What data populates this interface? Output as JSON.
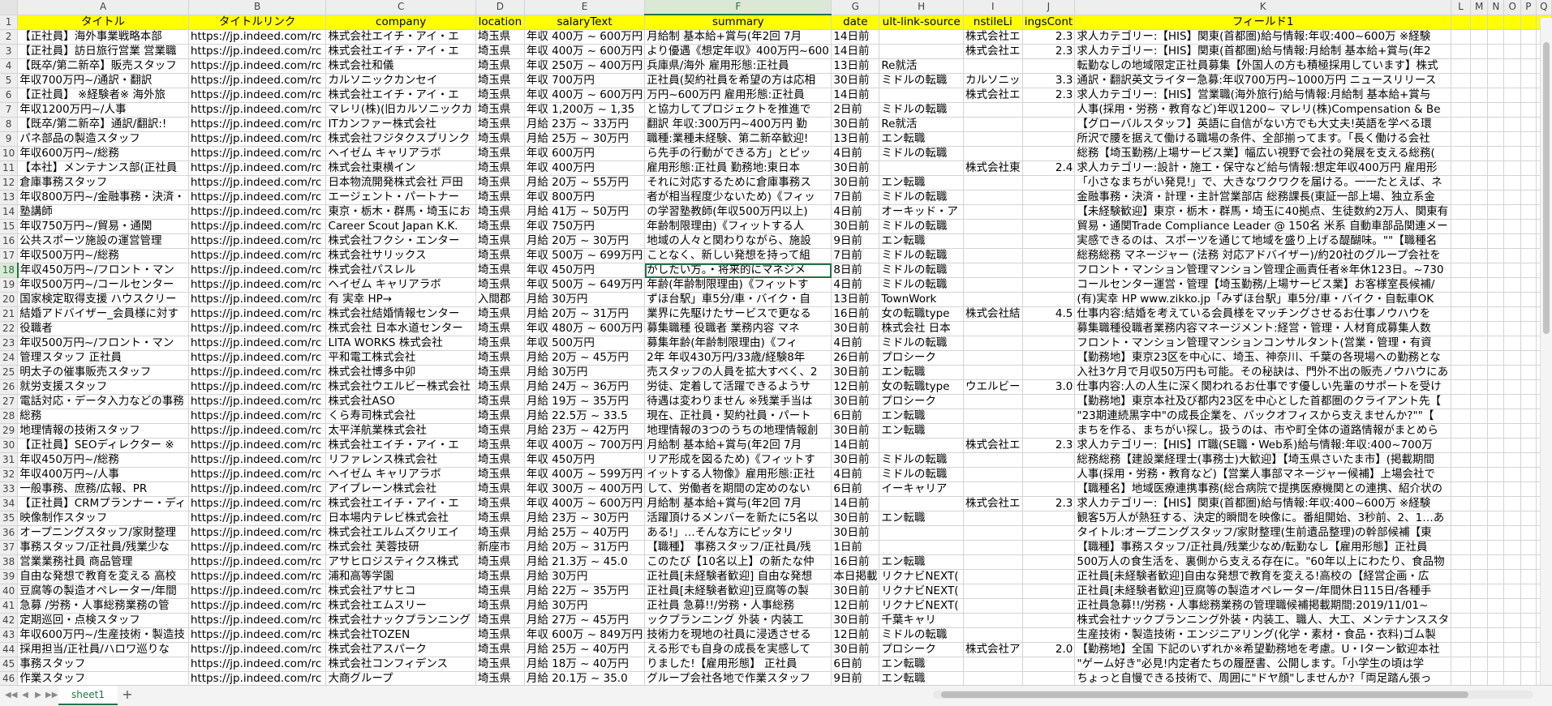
{
  "columns": [
    "A",
    "B",
    "C",
    "D",
    "E",
    "F",
    "G",
    "H",
    "I",
    "J",
    "K",
    "L",
    "M",
    "N",
    "O",
    "P",
    "Q"
  ],
  "active_column": "F",
  "active_row": 18,
  "header_row": [
    "タイトル",
    "タイトルリンク",
    "company",
    "location",
    "salaryText",
    "summary",
    "date",
    "ult-link-source",
    "nstileLi",
    "ingsCont",
    "フィールド1",
    "",
    "",
    "",
    "",
    "",
    ""
  ],
  "rows": [
    [
      "【正社員】海外事業戦略本部",
      "https://jp.indeed.com/rc",
      "株式会社エイチ・アイ・エ",
      "埼玉県",
      "年収 400万 ~ 600万円",
      "月給制 基本給+賞与(年2回 7月",
      "14日前",
      "",
      "株式会社エ",
      "2.3",
      "求人カテゴリー:【HIS】関東(首都圏)給与情報:年収:400~600万 ※経験"
    ],
    [
      "【正社員】訪日旅行営業 営業職",
      "https://jp.indeed.com/rc",
      "株式会社エイチ・アイ・エ",
      "埼玉県",
      "年収 400万 ~ 600万円",
      "より優遇《想定年収》400万円~600",
      "14日前",
      "",
      "株式会社エ",
      "2.3",
      "求人カテゴリー:【HIS】関東(首都圏)給与情報:月給制 基本給+賞与(年2"
    ],
    [
      "【既卒/第二新卒】販売スタッフ",
      "https://jp.indeed.com/rc",
      "株式会社和儀",
      "埼玉県",
      "年収 250万 ~ 400万円",
      "兵庫県/海外 雇用形態:正社員",
      "13日前",
      "Re就活",
      "",
      "",
      "転勤なしの地域限定正社員募集【外国人の方も積極採用しています】株式"
    ],
    [
      "年収700万円~/通訳・翻訳",
      "https://jp.indeed.com/rc",
      "カルソニックカンセイ",
      "埼玉県",
      "年収 700万円",
      "正社員(契約社員を希望の方は応相",
      "30日前",
      "ミドルの転職",
      "カルソニッ",
      "3.3",
      "通訳・翻訳英文ライター急募:年収700万円~1000万円 ニュースリリース"
    ],
    [
      "【正社員】 ※経験者※ 海外旅",
      "https://jp.indeed.com/rc",
      "株式会社エイチ・アイ・エ",
      "埼玉県",
      "年収 400万 ~ 600万円",
      "万円~600万円 雇用形態:正社員",
      "14日前",
      "",
      "株式会社エ",
      "2.3",
      "求人カテゴリー:【HIS】営業職(海外旅行)給与情報:月給制 基本給+賞与"
    ],
    [
      "年収1200万円~/人事",
      "https://jp.indeed.com/rc",
      "マレリ(株)(旧カルソニックカ",
      "埼玉県",
      "年収 1,200万 ~ 1,35",
      "と協力してプロジェクトを推進で",
      "2日前",
      "ミドルの転職",
      "",
      "",
      "人事(採用・労務・教育など)年収1200~ マレリ(株)Compensation & Be"
    ],
    [
      "【既卒/第二新卒】通訳/翻訳:!",
      "https://jp.indeed.com/rc",
      "ITカンファー株式会社",
      "埼玉県",
      "月給 23万 ~ 33万円",
      "翻訳 年収:300万円~400万円 勤",
      "30日前",
      "Re就活",
      "",
      "",
      "【グローバルスタッフ】英語に自信がない方でも大丈夫!英語を学べる環"
    ],
    [
      "パネ部品の製造スタッフ",
      "https://jp.indeed.com/rc",
      "株式会社フジタクスプリンク",
      "埼玉県",
      "月給 25万 ~ 30万円",
      "職種:業種未経験、第二新卒歓迎!",
      "13日前",
      "エン転職",
      "",
      "",
      "所沢で腰を据えて働ける職場の条件、全部揃ってます。「長く働ける会社"
    ],
    [
      "年収600万円~/総務",
      "https://jp.indeed.com/rc",
      "へイゼム キャリアラボ",
      "埼玉県",
      "年収 600万円",
      "ら先手の行動ができる方」とピッ",
      "4日前",
      "ミドルの転職",
      "",
      "",
      "総務【埼玉勤務/上場サービス業】幅広い視野で会社の発展を支える総務("
    ],
    [
      "【本社】メンテナンス部(正社員",
      "https://jp.indeed.com/rc",
      "株式会社東横イン",
      "埼玉県",
      "年収 400万円",
      "雇用形態:正社員 勤務地:東日本",
      "30日前",
      "",
      "株式会社東",
      "2.4",
      "求人カテゴリー:設計・施工・保守など給与情報:想定年収400万円 雇用形"
    ],
    [
      "倉庫事務スタッフ",
      "https://jp.indeed.com/rc",
      "日本物流開発株式会社 戸田",
      "埼玉県",
      "月給 20万 ~ 55万円",
      "それに対応するために倉庫事務ス",
      "30日前",
      "エン転職",
      "",
      "",
      "「小さなまちがい発見!」で、大きなワクワクを届ける。一一たとえば、ネ"
    ],
    [
      "年収800万円~/金融事務・決済・",
      "https://jp.indeed.com/rc",
      "エージェント・パートナー",
      "埼玉県",
      "年収 800万円",
      "者が相当程度少ないため)《フィッ",
      "7日前",
      "ミドルの転職",
      "",
      "",
      "金融事務・決済・計理・主計営業部店 総務課長(東証一部上場、独立系金"
    ],
    [
      "塾講師",
      "https://jp.indeed.com/rc",
      "東京・栃木・群馬・埼玉にお",
      "埼玉県",
      "月給 41万 ~ 50万円",
      "の学習塾教師(年収500万円以上)",
      "4日前",
      "オーキッド・ア",
      "",
      "",
      "【未経験歓迎】東京・栃木・群馬・埼玉に40拠点、生徒数約2万人、関東有"
    ],
    [
      "年収750万円~/貿易・通関",
      "https://jp.indeed.com/rc",
      "Career Scout Japan K.K.",
      "埼玉県",
      "年収 750万円",
      "年齢制限理由)《フィットする人",
      "30日前",
      "ミドルの転職",
      "",
      "",
      "貿易・通関Trade Compliance Leader @ 150名 米系 自動車部品関連メー"
    ],
    [
      "公共スポーツ施設の運営管理",
      "https://jp.indeed.com/rc",
      "株式会社フクシ・エンター",
      "埼玉県",
      "月給 20万 ~ 30万円",
      "地域の人々と関わりながら、施設",
      "9日前",
      "エン転職",
      "",
      "",
      "実感できるのは、スポーツを通じて地域を盛り上げる醍醐味。\"\"【職種名"
    ],
    [
      "年収500万円~/総務",
      "https://jp.indeed.com/rc",
      "株式会社サリックス",
      "埼玉県",
      "年収 500万 ~ 699万円",
      "ことなく、新しい発想を持って組",
      "7日前",
      "ミドルの転職",
      "",
      "",
      "総務総務 マネージャー (法務 対応アドバイザー)/約20社のグループ会社を"
    ],
    [
      "年収450万円~/フロント・マン",
      "https://jp.indeed.com/rc",
      "株式会社パスレル",
      "埼玉県",
      "年収 450万円",
      "がしたい方。・将来的にマネジメ",
      "8日前",
      "ミドルの転職",
      "",
      "",
      "フロント・マンション管理マンション管理企画責任者※年休123日。~730"
    ],
    [
      "年収500万円~/コールセンター",
      "https://jp.indeed.com/rc",
      "へイゼム キャリアラボ",
      "埼玉県",
      "年収 500万 ~ 649万円",
      "年齢(年齢制限理由)《フィットす",
      "4日前",
      "ミドルの転職",
      "",
      "",
      "コールセンター運営・管理【埼玉勤務/上場サービス業】お客様室長候補/"
    ],
    [
      "国家検定取得支援 ハウスクリー",
      "https://jp.indeed.com/rc",
      "有 実幸 HP→",
      "入間郡",
      "月給 30万円",
      "ずほ台駅」車5分/車・バイク・自",
      "13日前",
      "TownWork",
      "",
      "",
      "(有)実幸 HP www.zikko.jp「みずほ台駅」車5分/車・バイク・自転車OK"
    ],
    [
      "結婚アドバイザー_会員様に対す",
      "https://jp.indeed.com/rc",
      "株式会社結婚情報センター",
      "埼玉県",
      "月給 20万 ~ 31万円",
      "業界に先駆けたサービスで更なる",
      "16日前",
      "女の転職type",
      "株式会社結",
      "4.5",
      "仕事内容:結婚を考えている会員様をマッチングさせるお仕事ノウハウを"
    ],
    [
      "役職者",
      "https://jp.indeed.com/rc",
      "株式会社 日本水道センター",
      "埼玉県",
      "年収 480万 ~ 600万円",
      "募集職種 役職者 業務内容 マネ",
      "30日前",
      "株式会社 日本",
      "",
      "",
      "募集職種役職者業務内容マネージメント:経営・管理・人材育成募集人数"
    ],
    [
      "年収500万円~/フロント・マン",
      "https://jp.indeed.com/rc",
      "LITA WORKS 株式会社",
      "埼玉県",
      "年収 500万円",
      "募集年齢(年齢制限理由)《フィ",
      "4日前",
      "ミドルの転職",
      "",
      "",
      "フロント・マンション管理マンションコンサルタント(営業・管理・有資"
    ],
    [
      "管理スタッフ 正社員",
      "https://jp.indeed.com/rc",
      "平和電工株式会社",
      "埼玉県",
      "月給 20万 ~ 45万円",
      "2年 年収430万円/33歳/経験8年",
      "26日前",
      "プロシーク",
      "",
      "",
      "【勤務地】東京23区を中心に、埼玉、神奈川、千葉の各現場への勤務とな"
    ],
    [
      "明太子の催事販売スタッフ",
      "https://jp.indeed.com/rc",
      "株式会社博多中卯",
      "埼玉県",
      "月給 30万円",
      "売スタッフの人員を拡大すべく、2",
      "30日前",
      "エン転職",
      "",
      "",
      "入社3ケ月で月収50万円も可能。その秘訣は、門外不出の販売ノウハウにあ"
    ],
    [
      "就労支援スタッフ",
      "https://jp.indeed.com/rc",
      "株式会社ウエルビー株式会社",
      "埼玉県",
      "月給 24万 ~ 36万円",
      "労徒、定着して活躍できるようサ",
      "12日前",
      "女の転職type",
      "ウエルビー",
      "3.0",
      "仕事内容:人の人生に深く関われるお仕事です優しい先輩のサポートを受け"
    ],
    [
      "電話対応・データ入力などの事務",
      "https://jp.indeed.com/rc",
      "株式会社ASO",
      "埼玉県",
      "月給 19万 ~ 35万円",
      "待遇は変わりません ※残業手当は",
      "30日前",
      "プロシーク",
      "",
      "",
      "【勤務地】東京本社及び都内23区を中心とした首都圏のクライアント先【"
    ],
    [
      "総務",
      "https://jp.indeed.com/rc",
      "くら寿司株式会社",
      "埼玉県",
      "月給 22.5万 ~ 33.5",
      "現在、正社員・契約社員・パート",
      "6日前",
      "エン転職",
      "",
      "",
      "\"23期連続黒字中\"の成長企業を、バックオフィスから支えませんか?\"\"【"
    ],
    [
      "地理情報の技術スタッフ",
      "https://jp.indeed.com/rc",
      "太平洋航業株式会社",
      "埼玉県",
      "月給 23万 ~ 42万円",
      "地理情報の3つのうちの地理情報創",
      "30日前",
      "エン転職",
      "",
      "",
      "まちを作る、まちがい探し。扱うのは、市や町全体の道路情報がまとめら"
    ],
    [
      "【正社員】SEOディレクター ※",
      "https://jp.indeed.com/rc",
      "株式会社エイチ・アイ・エ",
      "埼玉県",
      "年収 400万 ~ 700万円",
      "月給制 基本給+賞与(年2回 7月",
      "14日前",
      "",
      "株式会社エ",
      "2.3",
      "求人カテゴリー:【HIS】IT職(SE職・Web系)給与情報:年収:400~700万"
    ],
    [
      "年収450万円~/総務",
      "https://jp.indeed.com/rc",
      "リファレンス株式会社",
      "埼玉県",
      "年収 450万円",
      "リア形成を図るため)《フィットす",
      "30日前",
      "ミドルの転職",
      "",
      "",
      "総務総務【建設業経理士(事務士)大歓迎】【埼玉県さいたま市】(掲載期間"
    ],
    [
      "年収400万円~/人事",
      "https://jp.indeed.com/rc",
      "へイゼム キャリアラボ",
      "埼玉県",
      "年収 400万 ~ 599万円",
      "イットする人物像》雇用形態:正社",
      "4日前",
      "ミドルの転職",
      "",
      "",
      "人事(採用・労務・教育など)【営業人事部マネージャー候補】上場会社で"
    ],
    [
      "一般事務、庶務/広報、PR",
      "https://jp.indeed.com/rc",
      "アイプレーン株式会社",
      "埼玉県",
      "年収 300万 ~ 400万円",
      "して、労働者を期間の定めのない",
      "6日前",
      "イーキャリア",
      "",
      "",
      "【職種名】地域医療連携事務(総合病院で提携医療機関との連携、紹介状の"
    ],
    [
      "【正社員】CRMプランナー・ディ",
      "https://jp.indeed.com/rc",
      "株式会社エイチ・アイ・エ",
      "埼玉県",
      "年収 400万 ~ 600万円",
      "月給制 基本給+賞与(年2回 7月",
      "14日前",
      "",
      "株式会社エ",
      "2.3",
      "求人カテゴリー:【HIS】関東(首都圏)給与情報:年収:400~600万 ※経験"
    ],
    [
      "映像制作スタッフ",
      "https://jp.indeed.com/rc",
      "日本場内テレビ株式会社",
      "埼玉県",
      "月給 23万 ~ 30万円",
      "活躍頂けるメンバーを新たに5名以",
      "30日前",
      "エン転職",
      "",
      "",
      "観客5万人が熱狂する、決定的瞬間を映像に。番組開始、3秒前、2、1…あ"
    ],
    [
      "オープニングスタッフ/家財整理",
      "https://jp.indeed.com/rc",
      "株式会社エルムズクリエイ",
      "埼玉県",
      "月給 25万 ~ 40万円",
      "ある!」…そんな方にピッタリ",
      "30日前",
      "",
      "",
      "",
      "タイトル:オープニングスタッフ/家財整理(生前遺品整理)の幹部候補【東"
    ],
    [
      "事務スタッフ/正社員/残業少な",
      "https://jp.indeed.com/rc",
      "株式会社 芙蓉技研",
      "新座市",
      "月給 20万 ~ 31万円",
      "【職種】 事務スタッフ/正社員/残",
      "1日前",
      "",
      "",
      "",
      "【職種】事務スタッフ/正社員/残業少なめ/転勤なし【雇用形態】正社員"
    ],
    [
      "営業業務社員 商品管理",
      "https://jp.indeed.com/rc",
      "アサヒロジスティクス株式",
      "埼玉県",
      "月給 21.3万 ~ 45.0",
      "このたび【10名以上】の新たな仲",
      "16日前",
      "エン転職",
      "",
      "",
      "500万人の食生活を、裏側から支える存在に。\"60年以上にわたり、食品物"
    ],
    [
      "自由な発想で教育を変える 高校",
      "https://jp.indeed.com/rc",
      "浦和高等学園",
      "埼玉県",
      "月給 30万円",
      "正社員[未経験者歓迎] 自由な発想",
      "本日掲載",
      "リクナビNEXT(",
      "",
      "",
      "正社員[未経験者歓迎]自由な発想で教育を変える!高校の【経営企画・広"
    ],
    [
      "豆腐等の製造オペレーター/年間",
      "https://jp.indeed.com/rc",
      "株式会社アサヒコ",
      "埼玉県",
      "月給 22万 ~ 35万円",
      "正社員[未経験者歓迎]豆腐等の製",
      "30日前",
      "リクナビNEXT(",
      "",
      "",
      "正社員[未経験者歓迎]豆腐等の製造オペレーター/年間休日115日/各種手"
    ],
    [
      "急募 /労務・人事総務業務の管",
      "https://jp.indeed.com/rc",
      "株式会社エムスリー",
      "埼玉県",
      "月給 30万円",
      "正社員 急募!!/労務・人事総務",
      "12日前",
      "リクナビNEXT(",
      "",
      "",
      "正社員急募!!/労務・人事総務業務の管理職候補掲載期間:2019/11/01~"
    ],
    [
      "定期巡回・点検スタッフ",
      "https://jp.indeed.com/rc",
      "株式会社ナックプランニング",
      "埼玉県",
      "月給 27万 ~ 45万円",
      "ックプランニング 外装・内装工",
      "30日前",
      "千葉キャリ",
      "",
      "",
      "株式会社ナックプランニング外装・内装工、職人、大工、メンテナンススタ"
    ],
    [
      "年収600万円~/生産技術・製造技",
      "https://jp.indeed.com/rc",
      "株式会社TOZEN",
      "埼玉県",
      "年収 600万 ~ 849万円",
      "技術力を現地の社員に浸透させる",
      "12日前",
      "ミドルの転職",
      "",
      "",
      "生産技術・製造技術・エンジニアリング(化学・素材・食品・衣料)ゴム製"
    ],
    [
      "採用担当/正社員/ハロワ巡りな",
      "https://jp.indeed.com/rc",
      "株式会社アスパーク",
      "埼玉県",
      "月給 25万 ~ 40万円",
      "える形でも自身の成長を実感して",
      "30日前",
      "プロシーク",
      "株式会社ア",
      "2.0",
      "【勤務地】全国 下記のいずれか※希望勤務地を考慮。U・Iターン歓迎本社"
    ],
    [
      "事務スタッフ",
      "https://jp.indeed.com/rc",
      "株式会社コンフィデンス",
      "埼玉県",
      "月給 18万 ~ 40万円",
      "りました!【雇用形態】 正社員",
      "6日前",
      "エン転職",
      "",
      "",
      "\"ゲーム好き\"必見!内定者たちの履歴書、公開します。「小学生の頃は学"
    ],
    [
      "作業スタッフ",
      "https://jp.indeed.com/rc",
      "大商グループ",
      "埼玉県",
      "月給 20.1万 ~ 35.0",
      "グループ会社各地で作業スタッフ",
      "9日前",
      "エン転職",
      "",
      "",
      "ちょっと自慢できる技術で、周囲に\"ドヤ顔\"しませんか?「両足踏ん張っ"
    ]
  ],
  "sheet_tab": "sheet1",
  "add_sheet_label": "+",
  "nav_icons": [
    "first-sheet-icon",
    "prev-sheet-icon",
    "next-sheet-icon",
    "last-sheet-icon"
  ],
  "colors": {
    "header_fill": "#ffff00",
    "accent": "#217346"
  }
}
